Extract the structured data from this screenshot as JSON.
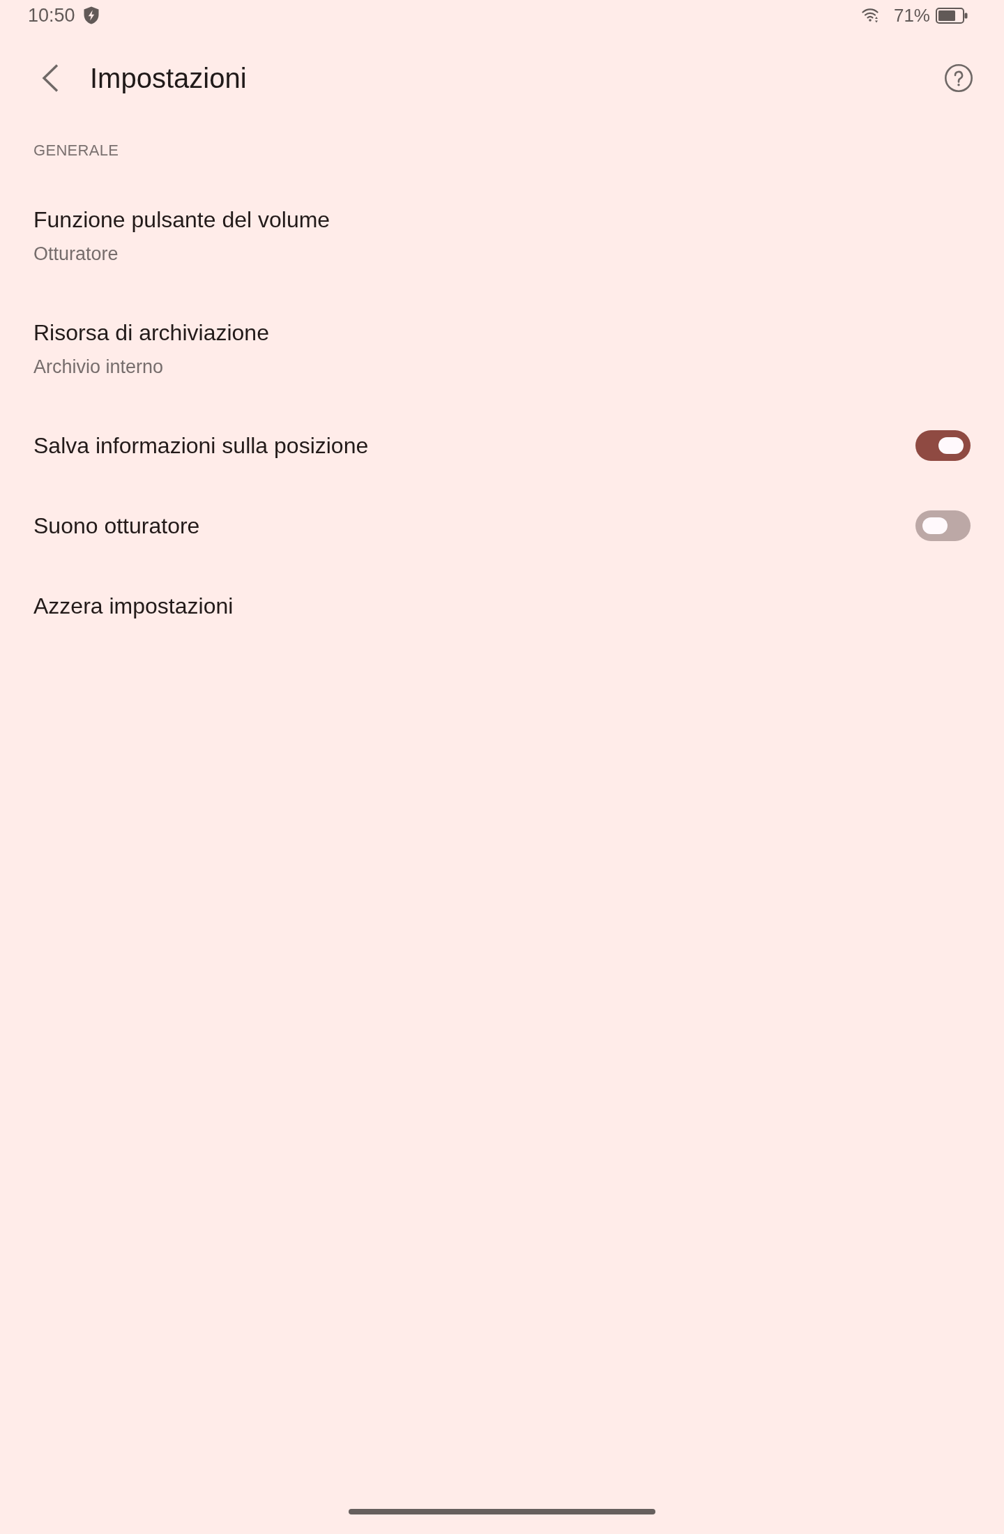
{
  "status_bar": {
    "time": "10:50",
    "battery": "71%"
  },
  "toolbar": {
    "title": "Impostazioni"
  },
  "sections": [
    {
      "title": "GENERALE",
      "items": [
        {
          "kind": "value",
          "title": "Funzione pulsante del volume",
          "value": "Otturatore"
        },
        {
          "kind": "value",
          "title": "Risorsa di archiviazione",
          "value": "Archivio interno"
        },
        {
          "kind": "switch",
          "title": "Salva informazioni sulla posizione",
          "on": true
        },
        {
          "kind": "switch",
          "title": "Suono otturatore",
          "on": false
        },
        {
          "kind": "action",
          "title": "Azzera impostazioni"
        }
      ]
    }
  ]
}
